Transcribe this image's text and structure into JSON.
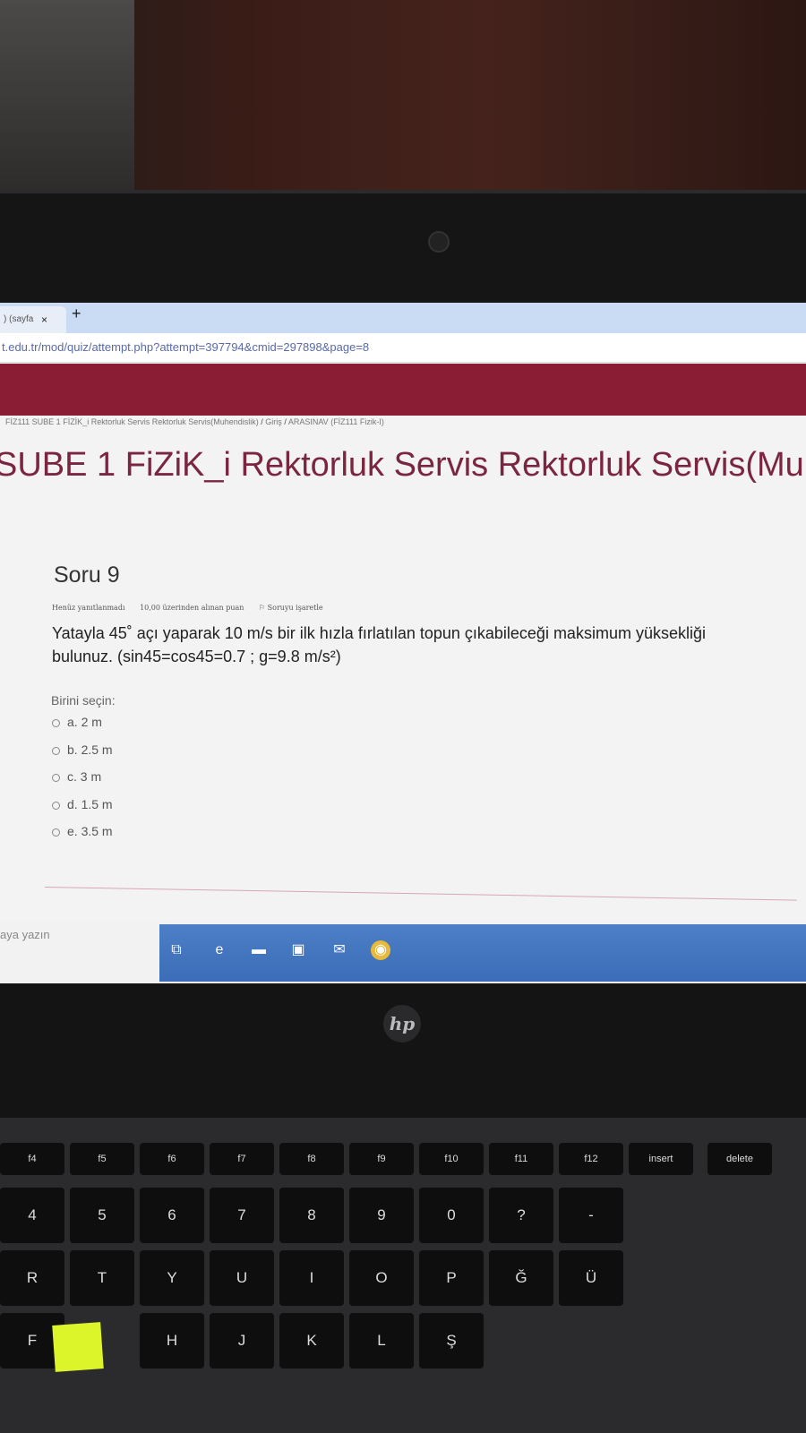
{
  "browser": {
    "tab_title": ") (sayfa",
    "tab_close": "×",
    "new_tab": "+",
    "url": "t.edu.tr/mod/quiz/attempt.php?attempt=397794&cmid=297898&page=8"
  },
  "breadcrumb": {
    "course": "FİZ111 SUBE 1 FİZİK_i Rektorluk Servis Rektorluk Servis(Muhendislik)",
    "sep": "/",
    "home": "Giriş",
    "exam": "ARASINAV (FİZ111 Fizik-I)"
  },
  "page_title": "SUBE 1 FiZiK_i Rektorluk Servis Rektorluk Servis(Muhendi",
  "question": {
    "title": "Soru 9",
    "status": "Henüz yanıtlanmadı",
    "points": "10,00 üzerinden alınan puan",
    "flag": "Soruyu işaretle",
    "text_line1": "Yatayla 45˚ açı yaparak 10 m/s bir ilk hızla fırlatılan topun çıkabileceği maksimum yüksekliği",
    "text_line2": "bulunuz. (sin45=cos45=0.7 ;  g=9.8 m/s²)",
    "choose_label": "Birini seçin:",
    "options": [
      "a. 2 m",
      "b. 2.5 m",
      "c. 3 m",
      "d. 1.5 m",
      "e. 3.5 m"
    ]
  },
  "taskbar": {
    "search_label": "aya yazın"
  },
  "laptop": {
    "logo": "hp",
    "fkeys": [
      "f4",
      "f5",
      "f6",
      "f7",
      "f8",
      "f9",
      "f10",
      "f11",
      "f12",
      "insert",
      "delete"
    ],
    "row1": [
      "4",
      "5",
      "6",
      "7",
      "8",
      "9",
      "0",
      "?",
      "-"
    ],
    "row2": [
      "R",
      "T",
      "Y",
      "U",
      "I",
      "O",
      "P",
      "Ğ",
      "Ü"
    ],
    "row3": [
      "F",
      "H",
      "J",
      "K",
      "L",
      "Ş"
    ]
  },
  "colors": {
    "banner": "#8a1c34",
    "title": "#7a2640",
    "taskbar": "#3c6db8"
  }
}
